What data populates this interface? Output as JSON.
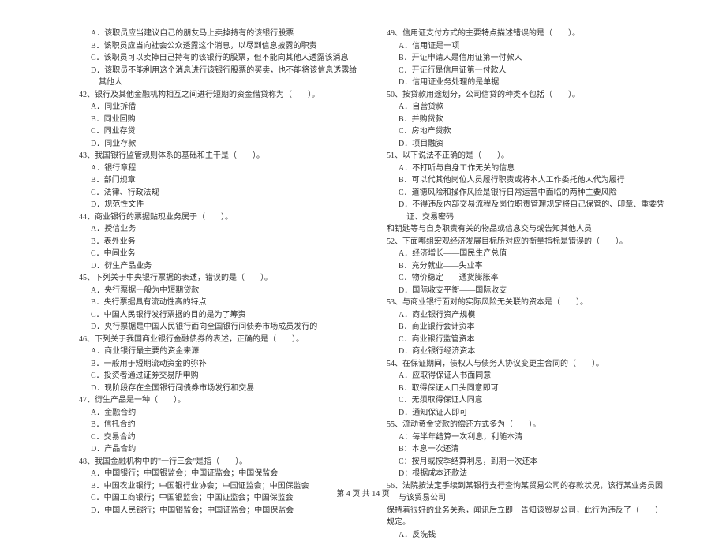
{
  "footer": "第 4 页 共 14 页",
  "left": {
    "q41_opts": [
      "A．该职员应当建议自己的朋友马上卖掉持有的该银行股票",
      "B．该职员应当向社会公众透露这个消息，以尽到信息披露的职责",
      "C．该职员可以卖掉自己持有的该银行的股票，但不能向其他人透露该消息",
      "D．该职员不能利用这个消息进行该银行股票的买卖，也不能将该信息透露给其他人"
    ],
    "q42": "42、银行及其他金融机构相互之间进行短期的资金借贷称为（　　）。",
    "q42_opts": [
      "A．同业拆借",
      "B．同业回购",
      "C．同业存贷",
      "D．同业存款"
    ],
    "q43": "43、我国银行监管规则体系的基础和主干是（　　）。",
    "q43_opts": [
      "A．银行章程",
      "B．部门规章",
      "C．法律、行政法规",
      "D．规范性文件"
    ],
    "q44": "44、商业银行的票据贴现业务属于（　　）。",
    "q44_opts": [
      "A．授信业务",
      "B．表外业务",
      "C．中间业务",
      "D．衍生产品业务"
    ],
    "q45": "45、下列关于中央银行票据的表述，错误的是（　　）。",
    "q45_opts": [
      "A．央行票据一般为中短期贷款",
      "B．央行票据具有流动性高的特点",
      "C．中国人民银行发行票据的目的是为了筹资",
      "D．央行票据是中国人民银行面向全国银行间债券市场成员发行的"
    ],
    "q46": "46、下列关于我国商业银行金融债券的表述，正确的是（　　）。",
    "q46_opts": [
      "A．商业银行最主要的资金来源",
      "B．一般用于短期流动资金的弥补",
      "C．投资者通过证券交易所申购",
      "D．现阶段存在全国银行间债券市场发行和交易"
    ],
    "q47": "47、衍生产品是一种（　　）。",
    "q47_opts": [
      "A．金融合约",
      "B．信托合约",
      "C．交易合约",
      "D．产品合约"
    ],
    "q48": "48、我国金融机构中的\"一行三会\"是指（　　）。",
    "q48_opts": [
      "A．中国银行；中国银监会；中国证监会；中国保监会",
      "B．中国农业银行；中国银行业协会；中国证监会；中国保监会",
      "C．中国工商银行；中国银监会；中国证监会；中国保监会",
      "D．中国人民银行；中国银监会；中国证监会；中国保监会"
    ]
  },
  "right": {
    "q49": "49、信用证支付方式的主要特点描述错误的是（　　）。",
    "q49_opts": [
      "A．信用证是一项",
      "B．开证申请人是信用证第一付款人",
      "C．开证行是信用证第一付款人",
      "D．信用证业务处理的是单据"
    ],
    "q50": "50、按贷款用途划分，公司信贷的种类不包括（　　）。",
    "q50_opts": [
      "A．自营贷款",
      "B．并购贷款",
      "C．房地产贷款",
      "D．项目融资"
    ],
    "q51": "51、以下说法不正确的是（　　）。",
    "q51_opts": [
      "A．不打听与自身工作无关的信息",
      "B．可以代其他岗位人员履行职责或将本人工作委托他人代为履行",
      "C．道德风险和操作风险是银行日常运营中面临的两种主要风险",
      "D．不得违反内部交易流程及岗位职责管理规定将自己保管的、印章、重要凭证、交易密码"
    ],
    "q51_extra": "和钥匙等与自身职责有关的物品或信息交与或告知其他人员",
    "q52": "52、下面哪组宏观经济发展目标所对应的衡量指标是错误的（　　）。",
    "q52_opts": [
      "A．经济增长——国民生产总值",
      "B．充分就业——失业率",
      "C．物价稳定——通货膨胀率",
      "D．国际收支平衡——国际收支"
    ],
    "q53": "53、与商业银行面对的实际风险无关联的资本是（　　）。",
    "q53_opts": [
      "A．商业银行资产规模",
      "B．商业银行会计资本",
      "C．商业银行监管资本",
      "D．商业银行经济资本"
    ],
    "q54": "54、在保证期间，债权人与债务人协议变更主合同的（　　）。",
    "q54_opts": [
      "A．应取得保证人书面同意",
      "B．取得保证人口头同意即可",
      "C．无须取得保证人同意",
      "D．通知保证人即可"
    ],
    "q55": "55、流动资金贷款的偿还方式多为（　　）。",
    "q55_opts": [
      "A：每半年结算一次利息，利随本清",
      "B：本息一次还清",
      "C：按月或按季结算利息，到期一次还本",
      "D：根据成本还款法"
    ],
    "q56": "56、法院按法定手续到某银行支行查询某贸易公司的存款状况，该行某业务员因与该贸易公司",
    "q56_extra": "保持着很好的业务关系，闻讯后立即　告知该贸易公司，此行为违反了（　　）规定。",
    "q56_opts": [
      "A．反洗钱"
    ]
  }
}
